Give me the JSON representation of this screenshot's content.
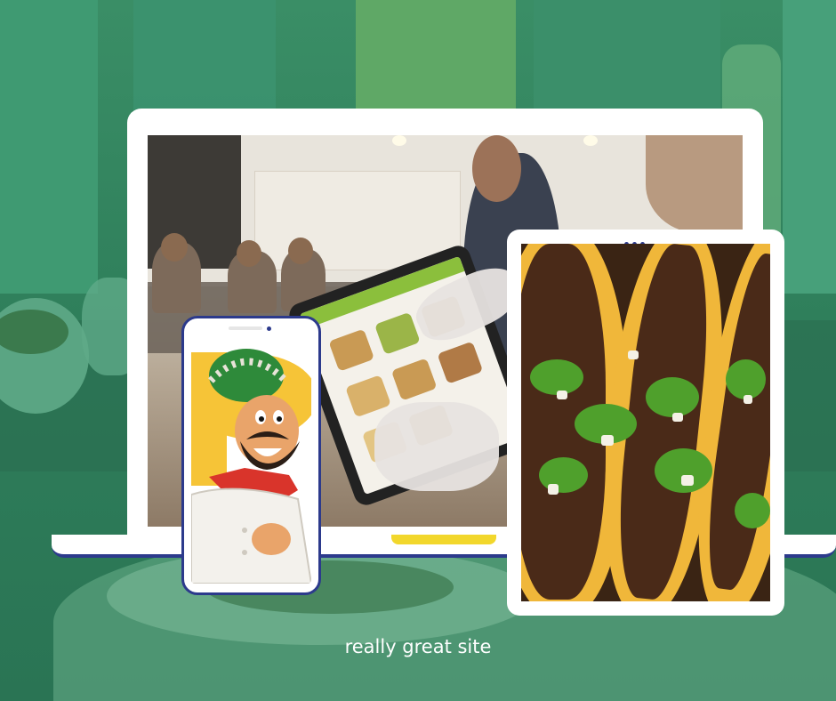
{
  "caption": "really great site",
  "colors": {
    "background_green": "#2f7d5a",
    "device_frame": "#ffffff",
    "device_accent": "#2c3a8c",
    "laptop_notch": "#f2d72c"
  },
  "images": {
    "laptop_screen": "photo-restaurant-staff-using-tablet-menu",
    "phone_screen": "cartoon-mexican-chef-mascot",
    "tablet_screen": "photo-birria-tacos-closeup"
  }
}
